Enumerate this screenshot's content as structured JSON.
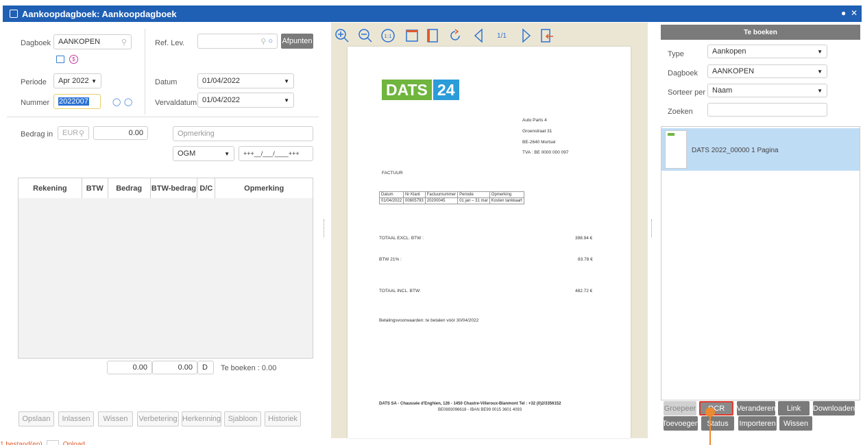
{
  "window": {
    "title": "Aankoopdagboek: Aankoopdagboek"
  },
  "form": {
    "dagboek_label": "Dagboek",
    "dagboek_value": "AANKOPEN",
    "ref_lev_label": "Ref. Lev.",
    "afpunten": "Afpunten",
    "periode_label": "Periode",
    "periode_value": "Apr 2022",
    "datum_label": "Datum",
    "datum_value": "01/04/2022",
    "nummer_label": "Nummer",
    "nummer_value": "2022007",
    "vervaldatum_label": "Vervaldatum",
    "vervaldatum_value": "01/04/2022",
    "bedrag_label": "Bedrag in",
    "currency": "EUR",
    "bedrag_value": "0.00",
    "opmerking_placeholder": "Opmerking",
    "ogm_value": "OGM",
    "ogm_field": "+++__/___/____+++"
  },
  "grid": {
    "columns": [
      "Rekening",
      "BTW",
      "Bedrag",
      "BTW-bedrag",
      "D/C",
      "Opmerking"
    ],
    "total_bedrag": "0.00",
    "total_btw": "0.00",
    "total_dc": "D",
    "te_boeken": "Te boeken : 0.00"
  },
  "bottom_buttons": [
    "Opslaan",
    "Inlassen",
    "Wissen",
    "Verbetering",
    "Herkenning",
    "Sjabloon",
    "Historiek"
  ],
  "status_bar": {
    "files": "1 bestand(en)",
    "upload": "Opload"
  },
  "viewer": {
    "page_indicator": "1/1"
  },
  "document": {
    "logo_left": "DATS",
    "logo_right": "24",
    "address": [
      "Auto Parts 4",
      "Groenstraat 31",
      "BE-2640 Mortsel",
      "TVA : BE 0000 000 097"
    ],
    "factuur": "FACTUUR",
    "table_headers": [
      "Datum",
      "Nr Klant",
      "Factuurnummer",
      "Periode",
      "Opmerking"
    ],
    "table_row": [
      "01/04/2022",
      "00605793",
      "20200045",
      "01 jan – 31 mar",
      "Kosten tankkaart"
    ],
    "totals": [
      {
        "label": "TOTAAL EXCL. BTW :",
        "value": "398.94 €"
      },
      {
        "label": "BTW 21% :",
        "value": "83.78 €"
      },
      {
        "label": "TOTAAL INCL. BTW:",
        "value": "482.72 €"
      }
    ],
    "payment": "Betalingsvoorwaarden: te betalen vóór 30/04/2022",
    "footer1": "DATS SA - Chaussée d'Enghien, 126 - 1450 Chastre-Villeroux-Blanmont   Tel : +32 (0)2/3356152",
    "footer2": "BE0893096618  -  IBAN BE99 0015 3601 4093"
  },
  "right": {
    "header": "Te boeken",
    "type_label": "Type",
    "type_value": "Aankopen",
    "dagboek_label": "Dagboek",
    "dagboek_value": "AANKOPEN",
    "sorteer_label": "Sorteer per",
    "sorteer_value": "Naam",
    "zoeken_label": "Zoeken",
    "item": "DATS 2022_00000 1 Pagina",
    "buttons_row1": [
      "Groepeer",
      "OCR",
      "Veranderen",
      "Link",
      "Downloaden"
    ],
    "buttons_row2": [
      "Toevoegen",
      "Status",
      "Importeren",
      "Wissen"
    ]
  },
  "colors": {
    "title_bar": "#1f5fb4",
    "accent": "#2a72d4",
    "highlight": "#e05a2b",
    "selection": "#bfdcf5"
  }
}
